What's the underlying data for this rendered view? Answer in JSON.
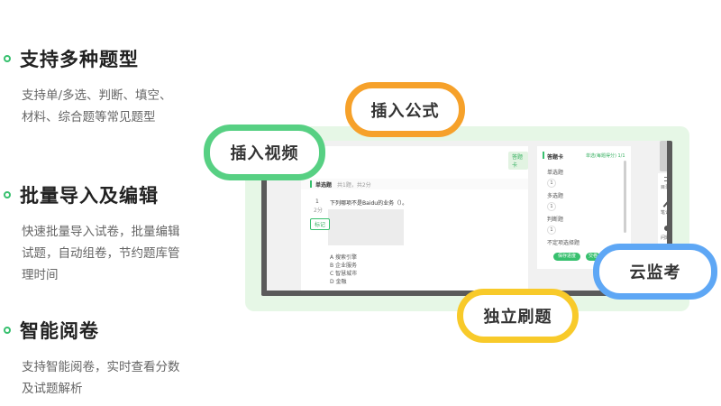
{
  "features": [
    {
      "title": "支持多种题型",
      "desc_lines": [
        "支持单/多选、判断、填空、",
        "材料、综合题等常见题型"
      ]
    },
    {
      "title": "批量导入及编辑",
      "desc_lines": [
        "快速批量导入试卷，批量编辑",
        "试题，自动组卷，节约题库管",
        "理时间"
      ]
    },
    {
      "title": "智能阅卷",
      "desc_lines": [
        "支持智能阅卷，实时查看分数",
        "及试题解析"
      ]
    }
  ],
  "pills": {
    "insert_formula": "插入公式",
    "insert_video": "插入视频",
    "cloud_proctor": "云监考",
    "independent_practice": "独立刷题"
  },
  "mock": {
    "top_tag": "答题卡",
    "section_title": "单选题",
    "section_meta": "共1题，共2分",
    "question_num": "1",
    "question_score": "2分",
    "question_text": "下列哪项不是Baidu的业务（）。",
    "mark_label": "标记",
    "options": [
      "A 搜索引擎",
      "B 企业服务",
      "C 智慧城市",
      "D 金融"
    ],
    "card_title": "答题卡",
    "card_link": "单选(每题得分) 1/1",
    "card_sections": [
      "单选题",
      "多选题",
      "判断题",
      "不定项选择题"
    ],
    "card_numbers": [
      "1",
      "1",
      "1"
    ],
    "card_btn_save": "保存进度",
    "card_btn_submit": "交卷",
    "tools": [
      "目录",
      "笔记",
      "问题"
    ]
  }
}
